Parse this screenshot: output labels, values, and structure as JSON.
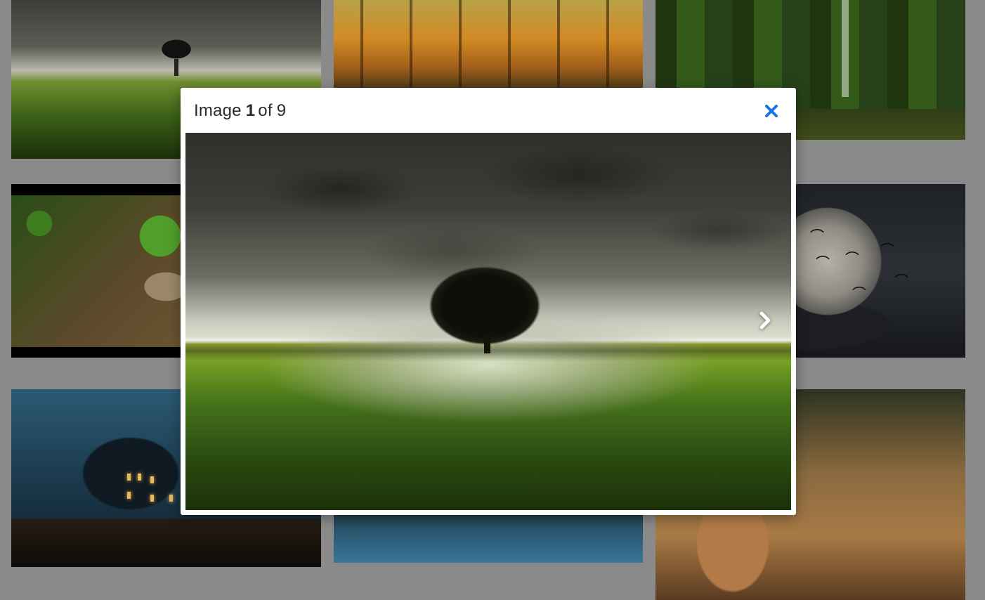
{
  "lightbox": {
    "title_prefix": "Image",
    "current_index": "1",
    "title_separator": "of",
    "total_count": "9",
    "close_icon": "close-icon",
    "next_icon": "chevron-right-icon",
    "accent_color": "#1a73e8"
  },
  "gallery": {
    "tiles": [
      {
        "subject": "tree-on-field"
      },
      {
        "subject": "autumn-forest"
      },
      {
        "subject": "mossy-waterfall"
      },
      {
        "subject": "tree-in-glass-bowl"
      },
      {
        "subject": "moon-with-bats"
      },
      {
        "subject": "haunted-house"
      },
      {
        "subject": "lake-with-animal"
      },
      {
        "subject": "deer"
      }
    ]
  }
}
